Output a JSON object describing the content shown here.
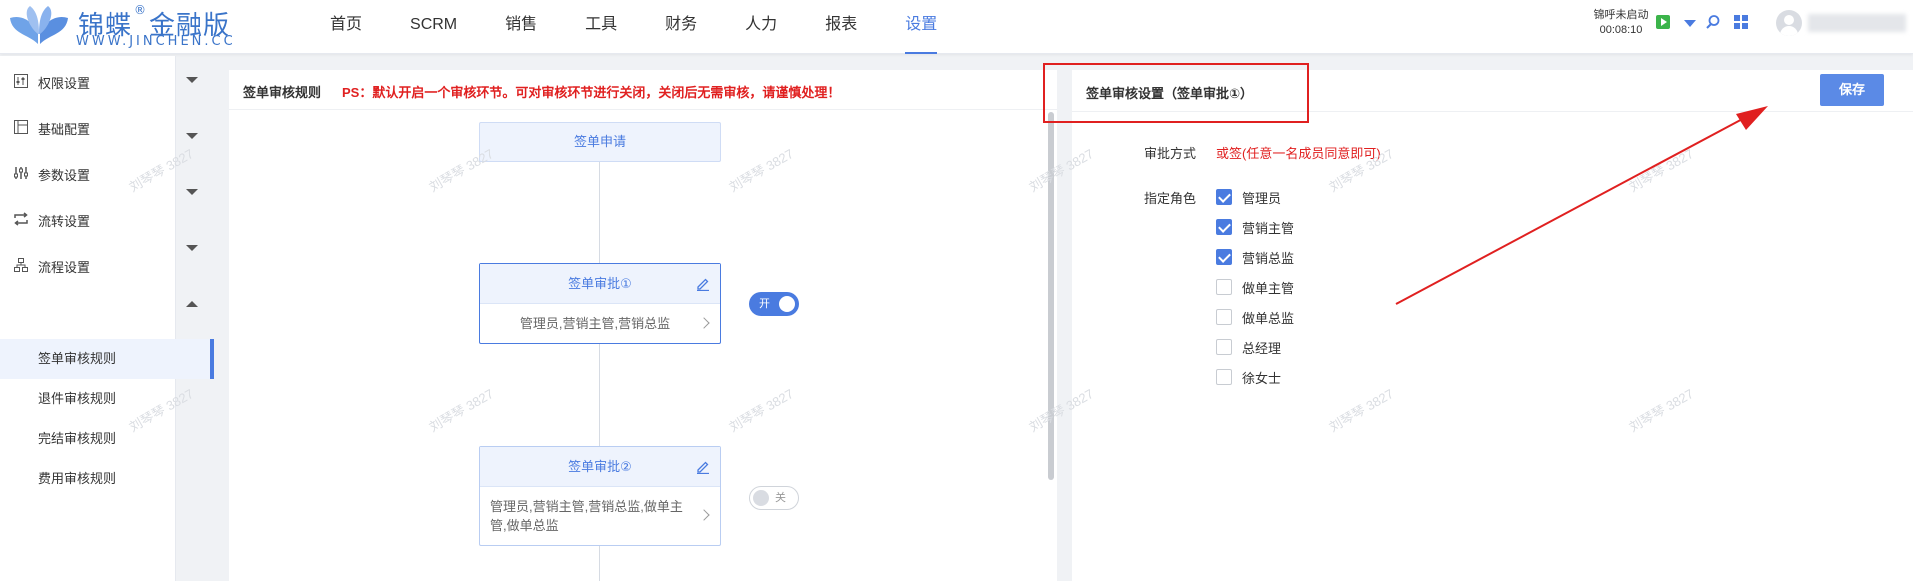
{
  "logo": {
    "cn_text": "锦蝶",
    "registered": "®",
    "edition": "金融版",
    "en_text": "WWW.JINCHEN.CC"
  },
  "nav": {
    "items": [
      {
        "label": "首页",
        "active": false
      },
      {
        "label": "SCRM",
        "active": false
      },
      {
        "label": "销售",
        "active": false
      },
      {
        "label": "工具",
        "active": false
      },
      {
        "label": "财务",
        "active": false
      },
      {
        "label": "人力",
        "active": false
      },
      {
        "label": "报表",
        "active": false
      },
      {
        "label": "设置",
        "active": true
      }
    ]
  },
  "header_right": {
    "call_status": "锦呼未启动",
    "call_timer": "00:08:10",
    "icons": [
      "play-icon",
      "caret-down-icon",
      "search-icon",
      "grid-icon",
      "avatar"
    ]
  },
  "sidebar": {
    "groups": [
      {
        "label": "权限设置",
        "icon": "permission-icon",
        "expanded": false
      },
      {
        "label": "基础配置",
        "icon": "basic-config-icon",
        "expanded": false
      },
      {
        "label": "参数设置",
        "icon": "parameter-icon",
        "expanded": false
      },
      {
        "label": "流转设置",
        "icon": "transfer-icon",
        "expanded": false
      },
      {
        "label": "流程设置",
        "icon": "process-icon",
        "expanded": true
      }
    ],
    "sub_items": [
      {
        "label": "签单审核规则",
        "active": true
      },
      {
        "label": "退件审核规则",
        "active": false
      },
      {
        "label": "完结审核规则",
        "active": false
      },
      {
        "label": "费用审核规则",
        "active": false
      }
    ]
  },
  "flow_panel": {
    "title": "签单审核规则",
    "note": "PS：默认开启一个审核环节。可对审核环节进行关闭，关闭后无需审核，请谨慎处理！",
    "start_node": "签单申请",
    "nodes": [
      {
        "title": "签单审批①",
        "roles": "管理员,营销主管,营销总监",
        "toggle_label": "开",
        "enabled": true
      },
      {
        "title": "签单审批②",
        "roles": "管理员,营销主管,营销总监,做单主管,做单总监",
        "toggle_label": "关",
        "enabled": false
      }
    ]
  },
  "settings_panel": {
    "title": "签单审核设置（签单审批①）",
    "save_label": "保存",
    "method_label": "审批方式",
    "method_value": "或签(任意一名成员同意即可)",
    "role_label": "指定角色",
    "roles": [
      {
        "label": "管理员",
        "checked": true
      },
      {
        "label": "营销主管",
        "checked": true
      },
      {
        "label": "营销总监",
        "checked": true
      },
      {
        "label": "做单主管",
        "checked": false
      },
      {
        "label": "做单总监",
        "checked": false
      },
      {
        "label": "总经理",
        "checked": false
      },
      {
        "label": "徐女士",
        "checked": false
      }
    ]
  },
  "watermark": "刘琴琴 3827",
  "colors": {
    "accent": "#4a7be0",
    "warning": "#e02020",
    "checkbox_checked": "#4a7be0",
    "toggle_on": "#4a7be0"
  }
}
